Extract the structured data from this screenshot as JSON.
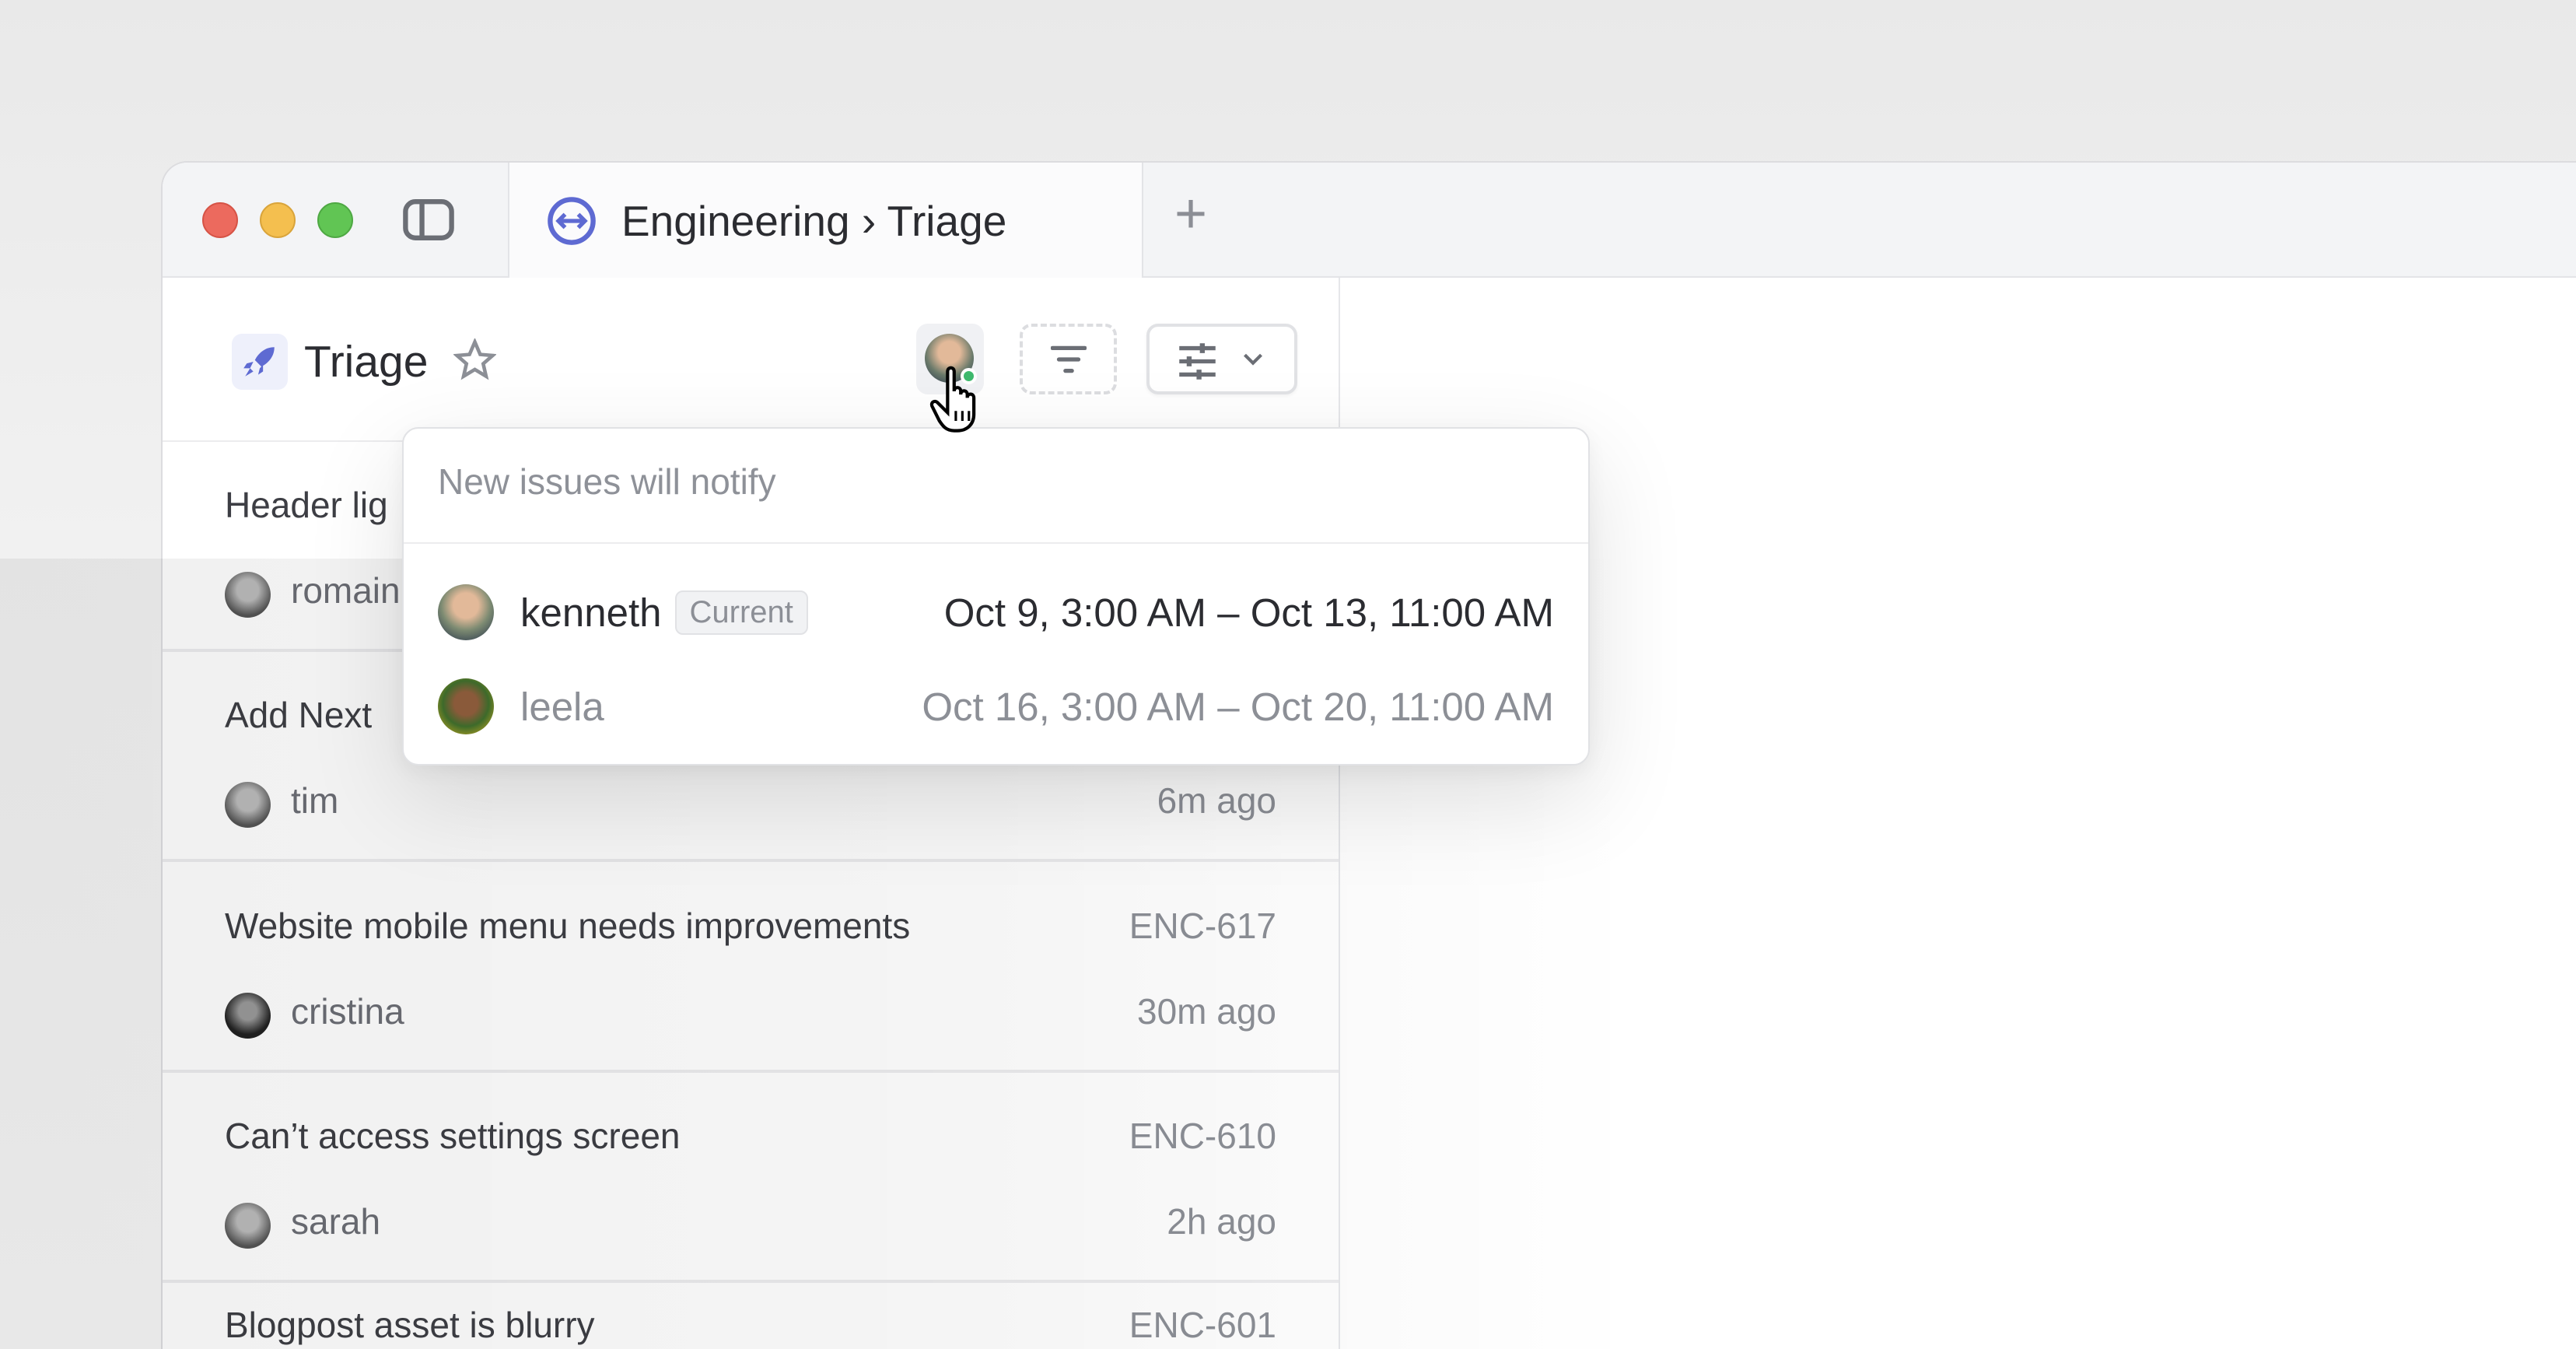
{
  "tab": {
    "title": "Engineering › Triage",
    "new_tab_icon": "plus-icon"
  },
  "header": {
    "title": "Triage"
  },
  "issues": [
    {
      "title": "Header lig",
      "user": "romain"
    },
    {
      "title": "Add Next",
      "user": "tim",
      "time": "6m ago"
    },
    {
      "title": "Website mobile menu needs improvements",
      "id": "ENC-617",
      "user": "cristina",
      "time": "30m ago"
    },
    {
      "title": "Can’t access settings screen",
      "id": "ENC-610",
      "user": "sarah",
      "time": "2h ago"
    },
    {
      "title": "Blogpost asset is blurry",
      "id": "ENC-601"
    }
  ],
  "popover": {
    "heading": "New issues will notify",
    "rows": [
      {
        "name": "kenneth",
        "badge": "Current",
        "range": "Oct 9, 3:00 AM – Oct 13, 11:00 AM"
      },
      {
        "name": "leela",
        "range": "Oct 16, 3:00 AM – Oct 20, 11:00 AM"
      }
    ]
  },
  "colors": {
    "accent": "#5e6ad2",
    "online": "#3fb96d"
  }
}
